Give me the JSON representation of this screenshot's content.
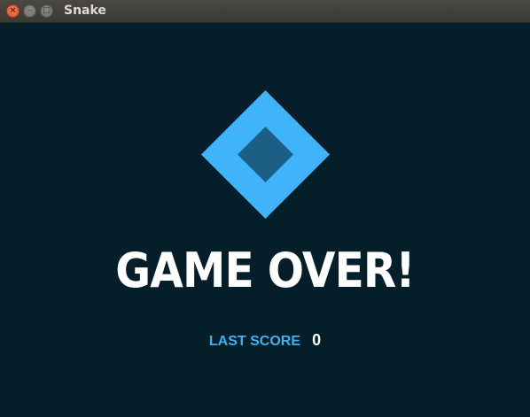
{
  "window": {
    "title": "Snake",
    "buttons": {
      "close_glyph": "×",
      "minimize_glyph": "–",
      "maximize_glyph": "□"
    }
  },
  "colors": {
    "background": "#051f2a",
    "accent": "#40b4fb",
    "inner_diamond": "#1d5e84",
    "heading": "#ffffff"
  },
  "game": {
    "logo_icon": "diamond-icon",
    "heading": "GAME OVER!",
    "last_score_label": "LAST SCORE",
    "last_score_value": "0"
  }
}
